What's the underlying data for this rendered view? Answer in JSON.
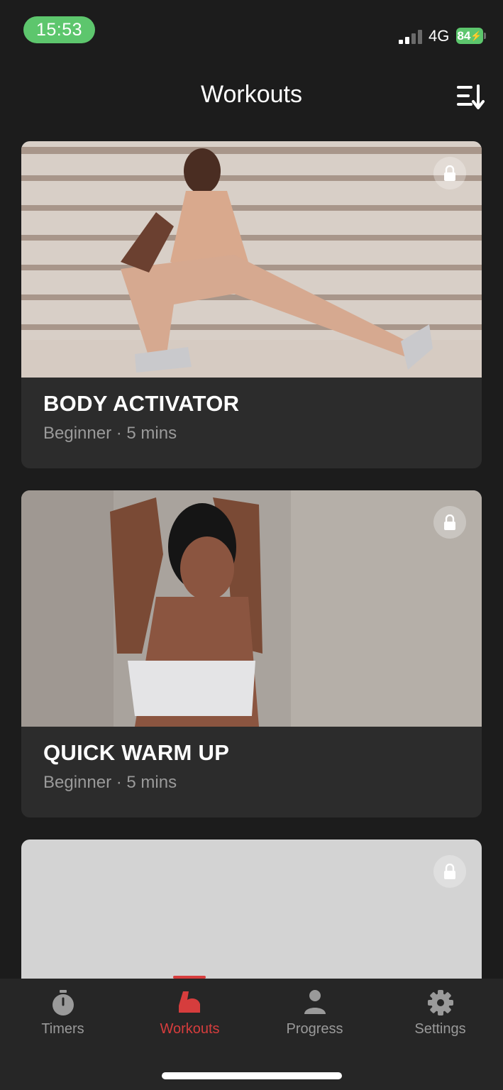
{
  "status": {
    "time": "15:53",
    "network": "4G",
    "battery": "84"
  },
  "header": {
    "title": "Workouts",
    "sort_icon": "sort-list-icon"
  },
  "cards": [
    {
      "title": "BODY ACTIVATOR",
      "meta": "Beginner · 5 mins",
      "locked": true,
      "image": "woman-lunge-stretch-photo"
    },
    {
      "title": "QUICK WARM UP",
      "meta": "Beginner · 5 mins",
      "locked": true,
      "image": "woman-arm-stretch-photo"
    },
    {
      "title": "",
      "meta": "",
      "locked": true,
      "image": "loading-placeholder"
    }
  ],
  "tabs": [
    {
      "label": "Timers",
      "icon": "stopwatch-icon",
      "active": false
    },
    {
      "label": "Workouts",
      "icon": "flexed-arm-icon",
      "active": true
    },
    {
      "label": "Progress",
      "icon": "person-icon",
      "active": false
    },
    {
      "label": "Settings",
      "icon": "gear-icon",
      "active": false
    }
  ],
  "colors": {
    "accent": "#d63d3d",
    "status_green": "#5dc66d",
    "background": "#1c1c1c",
    "card": "#2c2c2c"
  }
}
